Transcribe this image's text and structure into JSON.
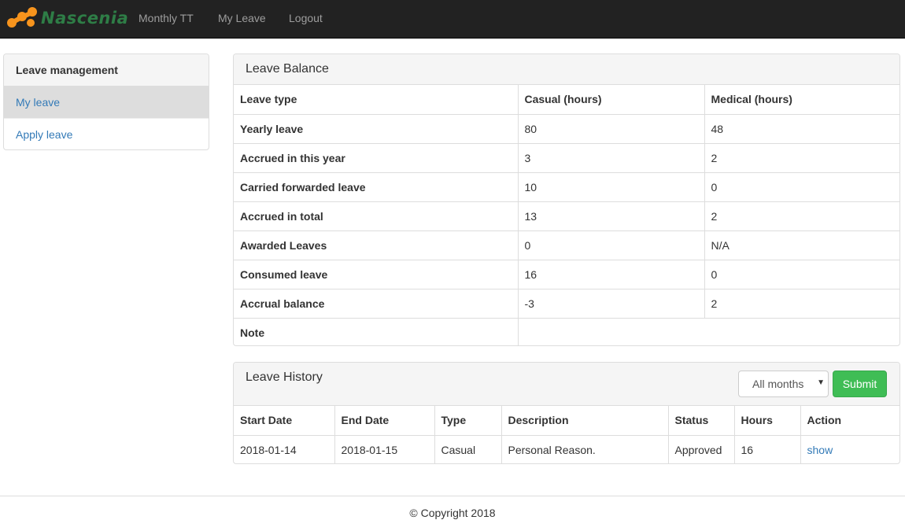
{
  "navbar": {
    "brand": "Nascenia",
    "links": [
      "Monthly TT",
      "My Leave",
      "Logout"
    ]
  },
  "sidebar": {
    "title": "Leave management",
    "items": [
      {
        "label": "My leave",
        "active": true
      },
      {
        "label": "Apply leave",
        "active": false
      }
    ]
  },
  "balance": {
    "title": "Leave Balance",
    "headers": [
      "Leave type",
      "Casual (hours)",
      "Medical (hours)"
    ],
    "rows": [
      {
        "label": "Yearly leave",
        "casual": "80",
        "medical": "48"
      },
      {
        "label": "Accrued in this year",
        "casual": "3",
        "medical": "2"
      },
      {
        "label": "Carried forwarded leave",
        "casual": "10",
        "medical": "0"
      },
      {
        "label": "Accrued in total",
        "casual": "13",
        "medical": "2"
      },
      {
        "label": "Awarded Leaves",
        "casual": "0",
        "medical": "N/A"
      },
      {
        "label": "Consumed leave",
        "casual": "16",
        "medical": "0"
      },
      {
        "label": "Accrual balance",
        "casual": "-3",
        "medical": "2"
      }
    ],
    "note_label": "Note",
    "note_value": ""
  },
  "history": {
    "title": "Leave History",
    "filter_value": "All months",
    "submit_label": "Submit",
    "headers": [
      "Start Date",
      "End Date",
      "Type",
      "Description",
      "Status",
      "Hours",
      "Action"
    ],
    "rows": [
      {
        "start": "2018-01-14",
        "end": "2018-01-15",
        "type": "Casual",
        "description": "Personal Reason.",
        "status": "Approved",
        "hours": "16",
        "action": "show"
      }
    ]
  },
  "footer": {
    "text": "© Copyright 2018"
  },
  "colors": {
    "navbar_bg": "#222222",
    "link": "#337ab7",
    "submit_bg": "#3fbd55",
    "brand_orange": "#f7941d",
    "brand_green": "#2e7d46"
  }
}
